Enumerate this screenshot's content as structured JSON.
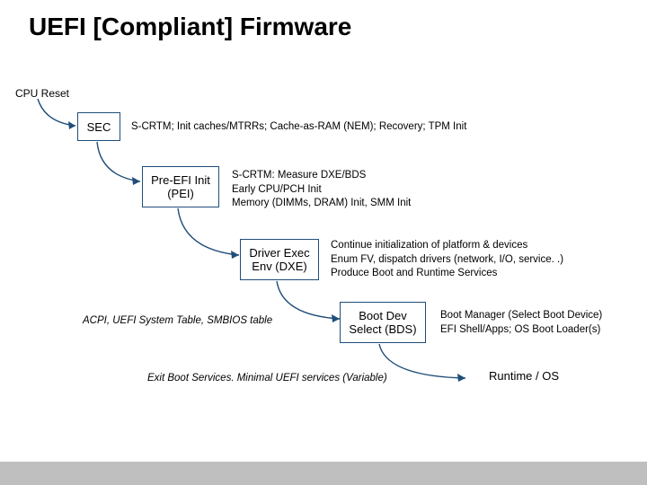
{
  "title": "UEFI [Compliant] Firmware",
  "cpu_reset": "CPU Reset",
  "stages": {
    "sec": {
      "name": "SEC",
      "desc": "S-CRTM; Init caches/MTRRs; Cache-as-RAM (NEM); Recovery; TPM Init"
    },
    "pei": {
      "name": "Pre-EFI Init\n(PEI)",
      "desc": "S-CRTM: Measure DXE/BDS\nEarly CPU/PCH Init\nMemory (DIMMs, DRAM) Init, SMM Init"
    },
    "dxe": {
      "name": "Driver Exec\nEnv (DXE)",
      "desc": "Continue initialization of platform & devices\nEnum FV, dispatch drivers (network, I/O, service. .)\nProduce Boot and Runtime Services"
    },
    "bds": {
      "name": "Boot Dev\nSelect (BDS)",
      "desc": "Boot Manager (Select Boot Device)\nEFI Shell/Apps; OS Boot Loader(s)",
      "left_note": "ACPI, UEFI System Table, SMBIOS table"
    },
    "rt": {
      "name": "Runtime / OS",
      "left_note": "Exit Boot Services. Minimal UEFI services (Variable)"
    }
  }
}
